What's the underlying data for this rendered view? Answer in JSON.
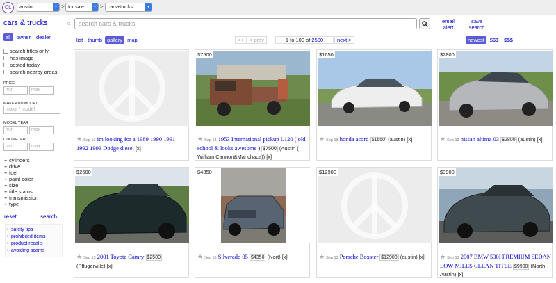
{
  "topbar": {
    "logo": "CL",
    "location": "austin",
    "section": "for sale",
    "category": "cars+trucks",
    "sep": ">"
  },
  "sidebar": {
    "title": "cars & trucks",
    "seller_filters": [
      "all",
      "owner",
      "dealer"
    ],
    "checks": [
      "search titles only",
      "has image",
      "posted today",
      "search nearby areas"
    ],
    "price": {
      "label": "PRICE",
      "min": "min",
      "max": "max"
    },
    "make": {
      "label": "MAKE AND MODEL",
      "placeholder": "make / model"
    },
    "year": {
      "label": "MODEL YEAR",
      "min": "min",
      "max": "max"
    },
    "odometer": {
      "label": "ODOMETER",
      "min": "min",
      "max": "max"
    },
    "expanders": [
      "cylinders",
      "drive",
      "fuel",
      "paint color",
      "size",
      "title status",
      "transmission",
      "type"
    ],
    "reset": "reset",
    "search": "search",
    "links": [
      "safety tips",
      "prohibited items",
      "product recalls",
      "avoiding scams"
    ]
  },
  "header": {
    "collapse": "«",
    "search_placeholder": "search cars & trucks",
    "email_alert": [
      "email",
      "alert"
    ],
    "save_search": [
      "save",
      "search"
    ]
  },
  "views": [
    "list",
    "thumb",
    "gallery",
    "map"
  ],
  "pagination": {
    "first": "<<",
    "prev": "< prev",
    "range_prefix": "1 to 100 of ",
    "total": "2500",
    "next": "next >"
  },
  "sort": [
    "newest",
    "$$$",
    "$$$"
  ],
  "listings": [
    {
      "price": "",
      "date": "Sep 13",
      "title": "im looking for a 1989 1990 1991 1992 1993 Dodge diesel",
      "price_badge": "",
      "loc": "",
      "x": "[x]",
      "image": "peace"
    },
    {
      "price": "$7500",
      "date": "Sep 13",
      "title": "1953 International pickup L120 ( old school & looks awesome )",
      "price_badge": "$7500",
      "loc": "(Austin ( William Cannon&Manchaca))",
      "x": "[x]",
      "image": "truck-rust"
    },
    {
      "price": "$1650",
      "date": "Sep 13",
      "title": "honda acord",
      "price_badge": "$1650",
      "loc": "(austin)",
      "x": "[x]",
      "image": "sedan-white"
    },
    {
      "price": "$2800",
      "date": "Sep 13",
      "title": "nissan altima 03",
      "price_badge": "$2800",
      "loc": "(austin)",
      "x": "[x]",
      "image": "sedan-silver"
    },
    {
      "price": "$2500",
      "date": "Sep 13",
      "title": "2001 Toyota Camry",
      "price_badge": "$2500",
      "loc": "(Pflugerville)",
      "x": "[x]",
      "image": "sedan-dark"
    },
    {
      "price": "$4350",
      "date": "Sep 13",
      "title": "Silverado 05",
      "price_badge": "$4350",
      "loc": "(Nort)",
      "x": "[x]",
      "image": "pickup-gray"
    },
    {
      "price": "$12900",
      "date": "Sep 13",
      "title": "Porsche Boxster",
      "price_badge": "$12900",
      "loc": "(austin)",
      "x": "[x]",
      "image": "peace"
    },
    {
      "price": "$9900",
      "date": "Sep 13",
      "title": "2007 BMW 530I PREMIUM SEDAN LOW MILES CLEAN TITLE",
      "price_badge": "$9900",
      "loc": "(North Austin)",
      "x": "[x]",
      "image": "bmw"
    }
  ]
}
